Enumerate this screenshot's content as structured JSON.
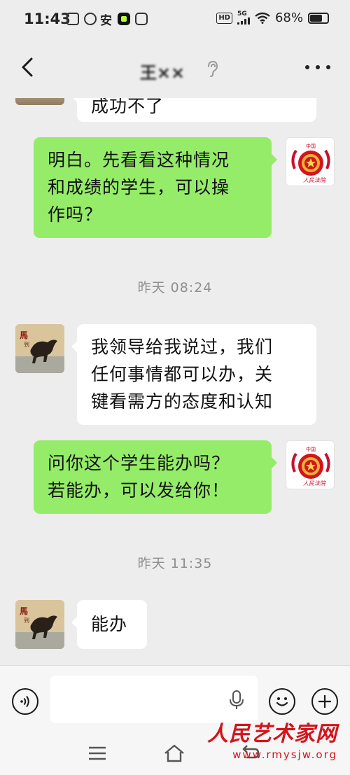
{
  "status_bar": {
    "time": "11:43",
    "app_icons": [
      "vivo-icon",
      "app-icon",
      "安",
      "green-app-icon",
      "game-icon"
    ],
    "hd_label": "HD",
    "network_label": "5G",
    "battery_percent": "68%",
    "battery_level": 0.68
  },
  "header": {
    "title": "王××",
    "more_label": "..."
  },
  "messages": [
    {
      "side": "in",
      "text": "成功不了",
      "avatar": "horse-painting"
    },
    {
      "side": "out",
      "lines": [
        "明白。先看看这种情况",
        "和成绩的学生，可以操",
        "作吗？"
      ],
      "avatar": "national-emblem"
    },
    {
      "type": "time",
      "text": "昨天 08:24"
    },
    {
      "side": "in",
      "lines": [
        "我领导给我说过，我们",
        "任何事情都可以办，关",
        "键看需方的态度和认知"
      ],
      "avatar": "horse-painting"
    },
    {
      "side": "out",
      "lines": [
        "问你这个学生能办吗？",
        "若能办，可以发给你！"
      ],
      "avatar": "national-emblem"
    },
    {
      "type": "time",
      "text": "昨天 11:35"
    },
    {
      "side": "in",
      "text": "能办",
      "avatar": "horse-painting"
    }
  ],
  "avatars": {
    "emblem_caption": "中国",
    "emblem_signature": "人民法院",
    "horse_caption": "马到成功"
  },
  "input_bar": {
    "placeholder": ""
  },
  "watermark": {
    "name": "人民艺术家网",
    "url": "www.rmysjw.org"
  },
  "colors": {
    "background": "#ededed",
    "outgoing_bubble": "#95ec69",
    "incoming_bubble": "#ffffff",
    "watermark_red": "#d4141b"
  }
}
